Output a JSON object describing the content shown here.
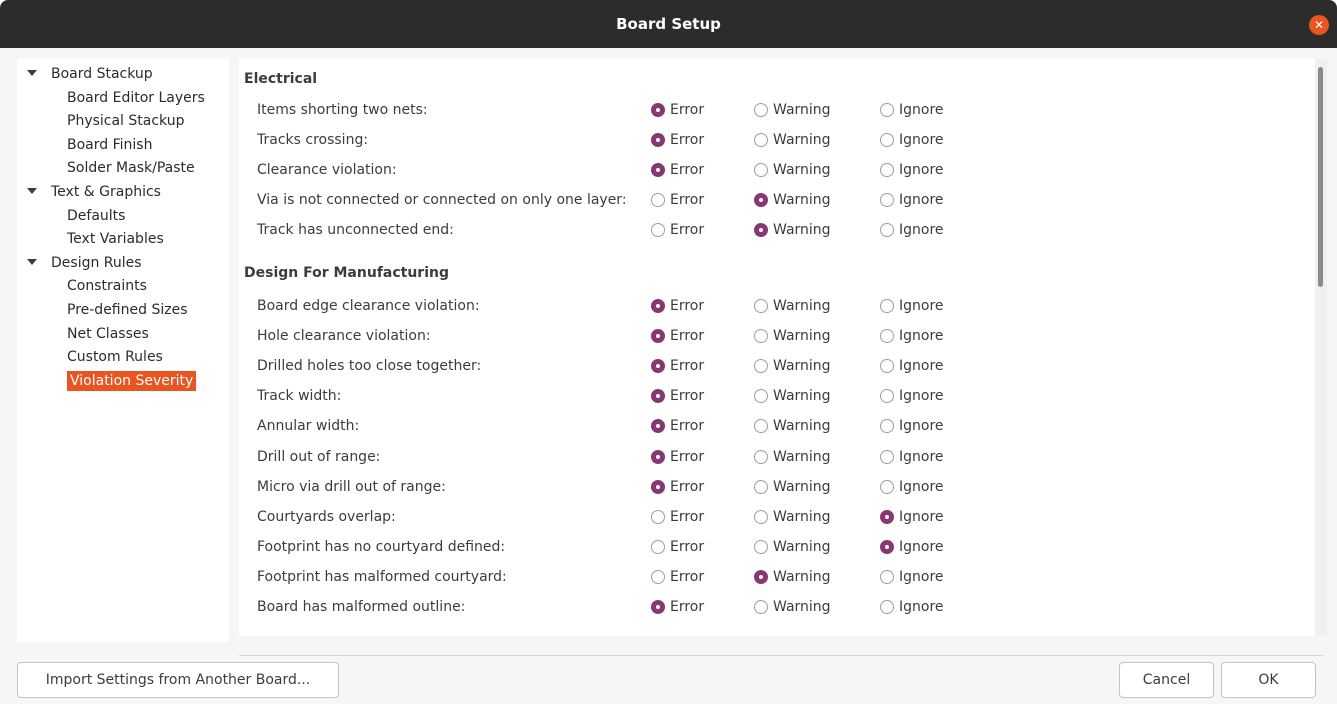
{
  "window": {
    "title": "Board Setup"
  },
  "tree": {
    "groups": [
      {
        "label": "Board Stackup",
        "items": [
          "Board Editor Layers",
          "Physical Stackup",
          "Board Finish",
          "Solder Mask/Paste"
        ]
      },
      {
        "label": "Text & Graphics",
        "items": [
          "Defaults",
          "Text Variables"
        ]
      },
      {
        "label": "Design Rules",
        "items": [
          "Constraints",
          "Pre-defined Sizes",
          "Net Classes",
          "Custom Rules",
          "Violation Severity"
        ]
      }
    ],
    "selected": "Violation Severity"
  },
  "options": {
    "error": "Error",
    "warning": "Warning",
    "ignore": "Ignore"
  },
  "sections": [
    {
      "title": "Electrical",
      "rows": [
        {
          "label": "Items shorting two nets:",
          "selected": "error"
        },
        {
          "label": "Tracks crossing:",
          "selected": "error"
        },
        {
          "label": "Clearance violation:",
          "selected": "error"
        },
        {
          "label": "Via is not connected or connected on only one layer:",
          "selected": "warning"
        },
        {
          "label": "Track has unconnected end:",
          "selected": "warning"
        }
      ]
    },
    {
      "title": "Design For Manufacturing",
      "rows": [
        {
          "label": "Board edge clearance violation:",
          "selected": "error"
        },
        {
          "label": "Hole clearance violation:",
          "selected": "error"
        },
        {
          "label": "Drilled holes too close together:",
          "selected": "error"
        },
        {
          "label": "Track width:",
          "selected": "error"
        },
        {
          "label": "Annular width:",
          "selected": "error"
        },
        {
          "label": "Drill out of range:",
          "selected": "error"
        },
        {
          "label": "Micro via drill out of range:",
          "selected": "error"
        },
        {
          "label": "Courtyards overlap:",
          "selected": "ignore"
        },
        {
          "label": "Footprint has no courtyard defined:",
          "selected": "ignore"
        },
        {
          "label": "Footprint has malformed courtyard:",
          "selected": "warning"
        },
        {
          "label": "Board has malformed outline:",
          "selected": "error"
        }
      ]
    }
  ],
  "buttons": {
    "import": "Import Settings from Another Board...",
    "cancel": "Cancel",
    "ok": "OK"
  },
  "colors": {
    "accent": "#e95420",
    "radio_checked": "#873772",
    "titlebar": "#2c2c2c"
  }
}
